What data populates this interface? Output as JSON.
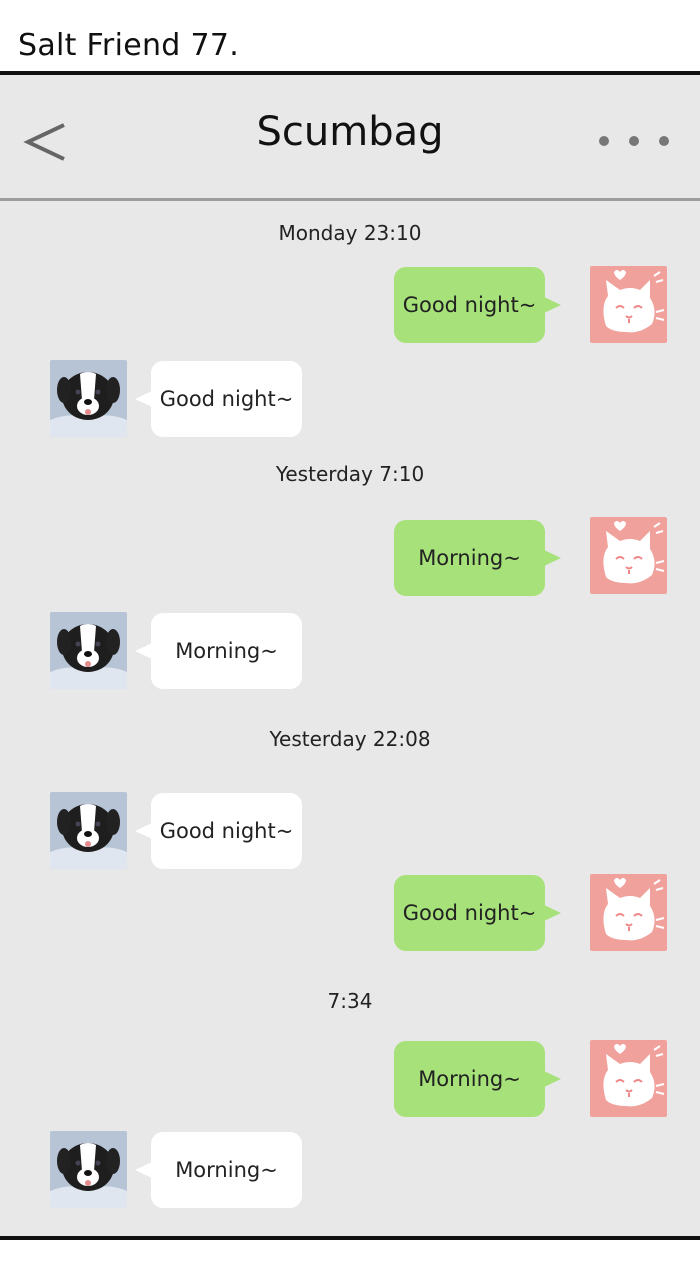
{
  "caption": "Salt Friend 77.",
  "header": {
    "title": "Scumbag",
    "back_icon": "chevron-left-icon",
    "more_icon": "more-dots-icon"
  },
  "colors": {
    "chat_background": "#e8e8e8",
    "sent_bubble": "#a6e179",
    "received_bubble": "#ffffff",
    "self_avatar": "#f1a19c",
    "divider": "#9c9c9c"
  },
  "conversation": [
    {
      "type": "timestamp",
      "text": "Monday 23:10"
    },
    {
      "type": "message",
      "side": "sent",
      "text": "Good night~",
      "avatar": "cat-avatar"
    },
    {
      "type": "message",
      "side": "received",
      "text": "Good night~",
      "avatar": "dog-avatar"
    },
    {
      "type": "timestamp",
      "text": "Yesterday 7:10"
    },
    {
      "type": "message",
      "side": "sent",
      "text": "Morning~",
      "avatar": "cat-avatar"
    },
    {
      "type": "message",
      "side": "received",
      "text": "Morning~",
      "avatar": "dog-avatar"
    },
    {
      "type": "timestamp",
      "text": "Yesterday 22:08"
    },
    {
      "type": "message",
      "side": "received",
      "text": "Good night~",
      "avatar": "dog-avatar"
    },
    {
      "type": "message",
      "side": "sent",
      "text": "Good night~",
      "avatar": "cat-avatar"
    },
    {
      "type": "timestamp",
      "text": "7:34"
    },
    {
      "type": "message",
      "side": "sent",
      "text": "Morning~",
      "avatar": "cat-avatar"
    },
    {
      "type": "message",
      "side": "received",
      "text": "Morning~",
      "avatar": "dog-avatar"
    }
  ]
}
